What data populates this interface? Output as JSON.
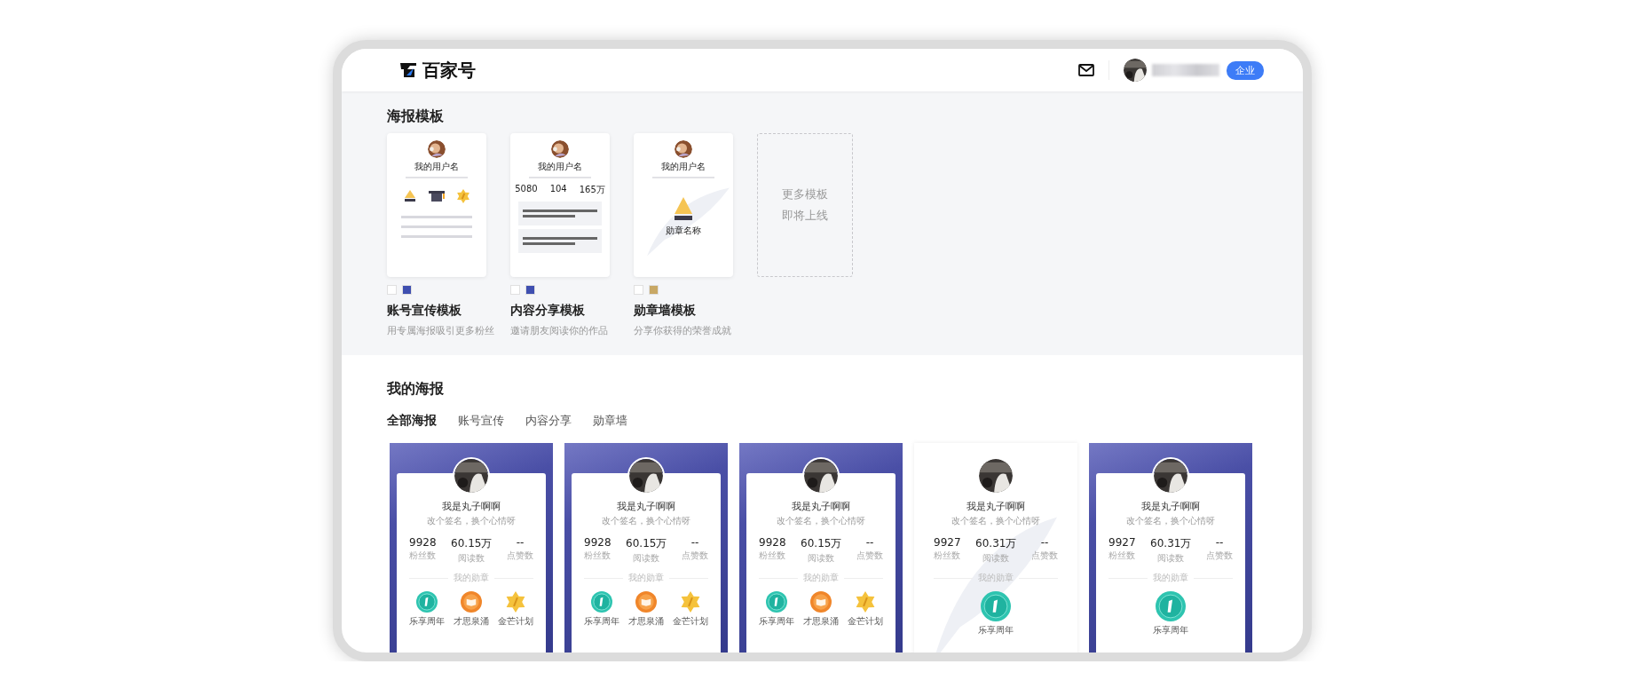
{
  "header": {
    "logo": "百家号",
    "badge": "企业"
  },
  "templates_section": {
    "title": "海报模板",
    "templates": [
      {
        "kind": "account",
        "preview_name": "我的用户名",
        "swatches": [
          {
            "color": "#ffffff"
          },
          {
            "color": "#3f4fb0"
          }
        ],
        "name": "账号宣传模板",
        "description": "用专属海报吸引更多粉丝"
      },
      {
        "kind": "content",
        "preview_name": "我的用户名",
        "stats": [
          "5080",
          "104",
          "165万"
        ],
        "swatches": [
          {
            "color": "#ffffff"
          },
          {
            "color": "#3f4fb0"
          }
        ],
        "name": "内容分享模板",
        "description": "邀请朋友阅读你的作品"
      },
      {
        "kind": "medal",
        "preview_name": "我的用户名",
        "medal_name": "勋章名称",
        "swatches": [
          {
            "color": "#ffffff"
          },
          {
            "color": "#c8a865"
          }
        ],
        "name": "勋章墙模板",
        "description": "分享你获得的荣誉成就"
      }
    ],
    "more": [
      "更多模板",
      "即将上线"
    ]
  },
  "posters_section": {
    "title": "我的海报",
    "tabs": [
      {
        "label": "全部海报",
        "selected": true
      },
      {
        "label": "账号宣传",
        "selected": false
      },
      {
        "label": "内容分享",
        "selected": false
      },
      {
        "label": "勋章墙",
        "selected": false
      }
    ],
    "posters": [
      {
        "kind": "banner",
        "name": "我是丸子啊啊",
        "signature": "改个签名，换个心情呀",
        "stats": [
          {
            "value": "9928",
            "label": "粉丝数"
          },
          {
            "value": "60.15万",
            "label": "阅读数"
          },
          {
            "value": "--",
            "label": "点赞数"
          }
        ],
        "medal_heading": "我的勋章",
        "medals": [
          {
            "kind": "anniversary",
            "label": "乐享周年"
          },
          {
            "kind": "book",
            "label": "才思泉涌"
          },
          {
            "kind": "star",
            "label": "金芒计划"
          }
        ]
      },
      {
        "kind": "banner",
        "name": "我是丸子啊啊",
        "signature": "改个签名，换个心情呀",
        "stats": [
          {
            "value": "9928",
            "label": "粉丝数"
          },
          {
            "value": "60.15万",
            "label": "阅读数"
          },
          {
            "value": "--",
            "label": "点赞数"
          }
        ],
        "medal_heading": "我的勋章",
        "medals": [
          {
            "kind": "anniversary",
            "label": "乐享周年"
          },
          {
            "kind": "book",
            "label": "才思泉涌"
          },
          {
            "kind": "star",
            "label": "金芒计划"
          }
        ]
      },
      {
        "kind": "banner",
        "name": "我是丸子啊啊",
        "signature": "改个签名，换个心情呀",
        "stats": [
          {
            "value": "9928",
            "label": "粉丝数"
          },
          {
            "value": "60.15万",
            "label": "阅读数"
          },
          {
            "value": "--",
            "label": "点赞数"
          }
        ],
        "medal_heading": "我的勋章",
        "medals": [
          {
            "kind": "anniversary",
            "label": "乐享周年"
          },
          {
            "kind": "book",
            "label": "才思泉涌"
          },
          {
            "kind": "star",
            "label": "金芒计划"
          }
        ]
      },
      {
        "kind": "plain",
        "name": "我是丸子啊啊",
        "signature": "改个签名，换个心情呀",
        "stats": [
          {
            "value": "9927",
            "label": "粉丝数"
          },
          {
            "value": "60.31万",
            "label": "阅读数"
          },
          {
            "value": "--",
            "label": "点赞数"
          }
        ],
        "medal_heading": "我的勋章",
        "medals": [
          {
            "kind": "anniversary_large",
            "label": "乐享周年"
          }
        ]
      },
      {
        "kind": "banner",
        "name": "我是丸子啊啊",
        "signature": "改个签名，换个心情呀",
        "stats": [
          {
            "value": "9927",
            "label": "粉丝数"
          },
          {
            "value": "60.31万",
            "label": "阅读数"
          },
          {
            "value": "--",
            "label": "点赞数"
          }
        ],
        "medal_heading": "我的勋章",
        "medals": [
          {
            "kind": "anniversary_large",
            "label": "乐享周年"
          }
        ]
      }
    ]
  }
}
